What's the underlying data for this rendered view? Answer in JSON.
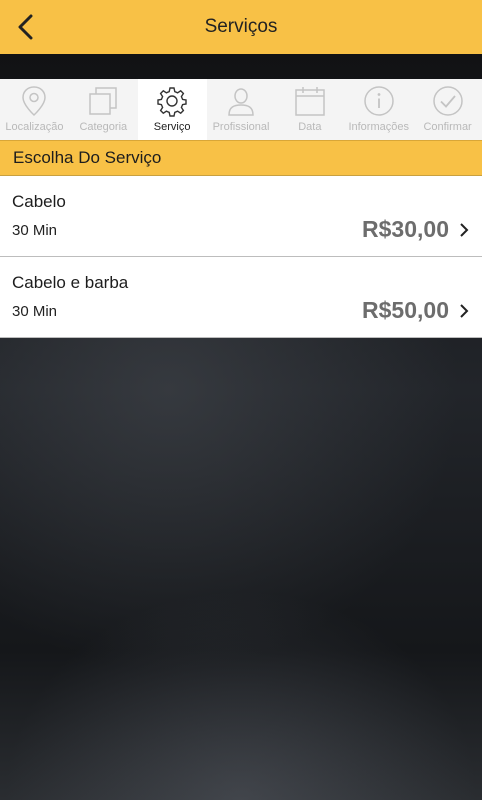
{
  "header": {
    "title": "Serviços",
    "back_icon": "chevron-left-icon",
    "bg_color": "#f8c146"
  },
  "steps": [
    {
      "key": "localizacao",
      "label": "Localização",
      "icon": "location-pin-icon",
      "active": false
    },
    {
      "key": "categoria",
      "label": "Categoria",
      "icon": "squares-icon",
      "active": false
    },
    {
      "key": "servico",
      "label": "Serviço",
      "icon": "gear-icon",
      "active": true
    },
    {
      "key": "profissional",
      "label": "Profissional",
      "icon": "person-icon",
      "active": false
    },
    {
      "key": "data",
      "label": "Data",
      "icon": "calendar-icon",
      "active": false
    },
    {
      "key": "informacoes",
      "label": "Informações",
      "icon": "info-icon",
      "active": false
    },
    {
      "key": "confirmar",
      "label": "Confirmar",
      "icon": "check-circle-icon",
      "active": false
    }
  ],
  "section": {
    "title": "Escolha Do Serviço"
  },
  "services": [
    {
      "name": "Cabelo",
      "duration": "30 Min",
      "price": "R$30,00"
    },
    {
      "name": "Cabelo e barba",
      "duration": "30 Min",
      "price": "R$50,00"
    }
  ]
}
